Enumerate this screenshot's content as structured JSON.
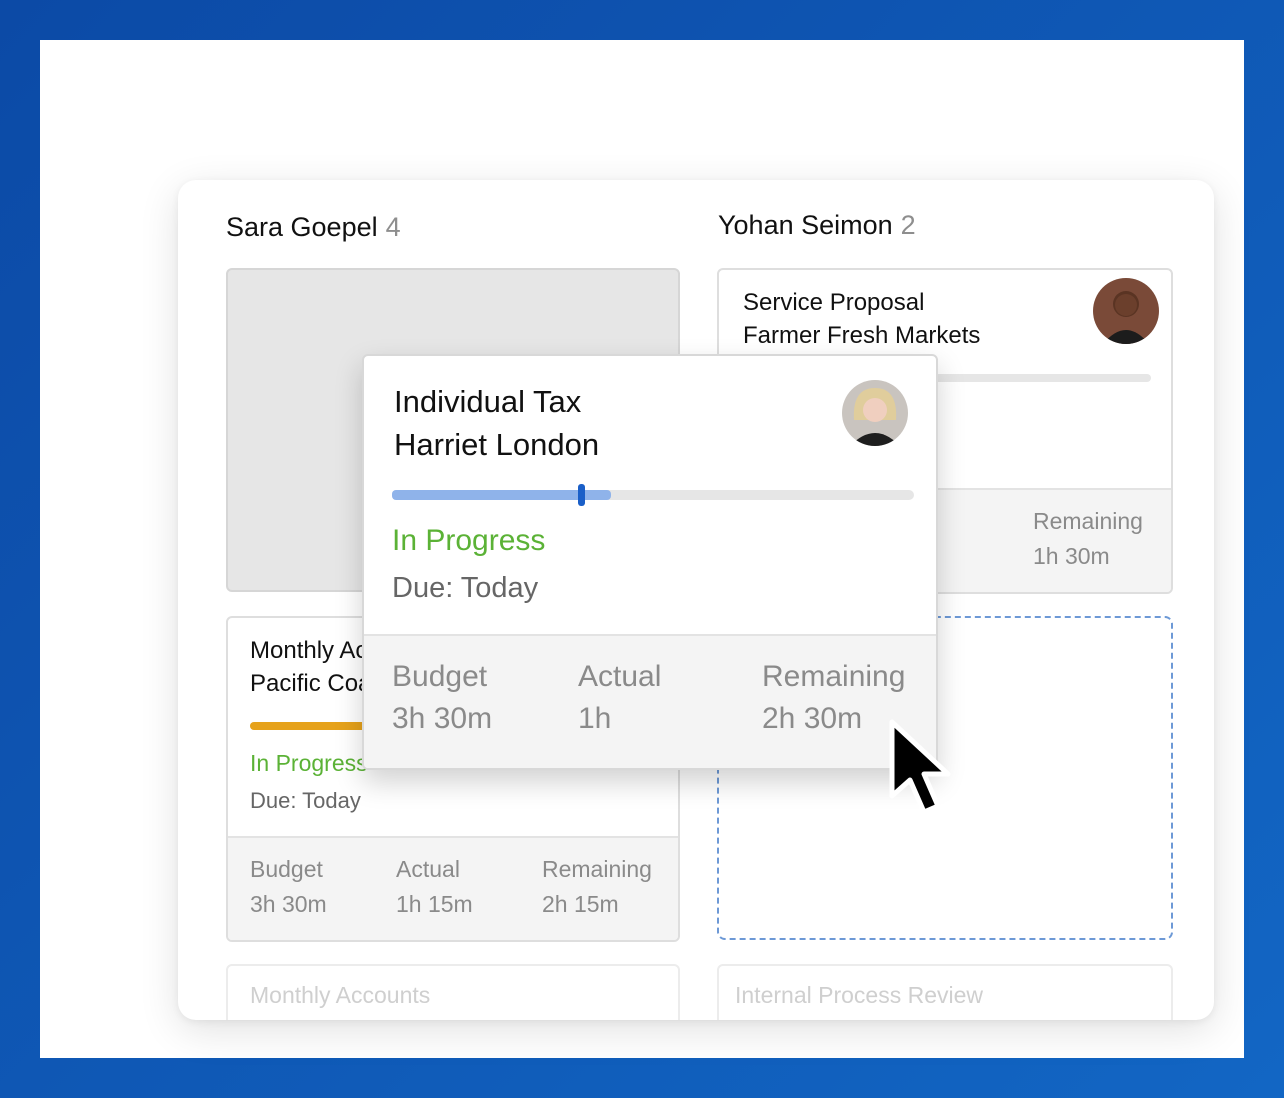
{
  "columns": [
    {
      "name": "Sara Goepel",
      "count": "4"
    },
    {
      "name": "Yohan Seimon",
      "count": "2"
    }
  ],
  "cards": {
    "service_proposal": {
      "line1": "Service Proposal",
      "line2": "Farmer Fresh Markets",
      "progress": 0.27,
      "progress_color": "#8fb3ea",
      "handle_color": "#1a5fc8",
      "avatar": "avatar-man-icon",
      "stats": [
        {
          "label": "Remaining",
          "value": "1h 30m"
        }
      ]
    },
    "monthly_accounts": {
      "line1": "Monthly Accou",
      "line2": "Pacific Coast",
      "progress": 0.53,
      "progress_color": "#e6a21b",
      "status": "In Progress",
      "due": "Due: Today",
      "stats": [
        {
          "label": "Budget",
          "value": "3h 30m"
        },
        {
          "label": "Actual",
          "value": "1h 15m"
        },
        {
          "label": "Remaining",
          "value": "2h 15m"
        }
      ]
    },
    "dragged": {
      "line1": "Individual Tax",
      "line2": "Harriet London",
      "progress": 0.42,
      "progress_color": "#8fb3ea",
      "handle_color": "#1a5fc8",
      "avatar": "avatar-woman-icon",
      "status": "In Progress",
      "due": "Due: Today",
      "stats": [
        {
          "label": "Budget",
          "value": "3h 30m"
        },
        {
          "label": "Actual",
          "value": "1h"
        },
        {
          "label": "Remaining",
          "value": "2h 30m"
        }
      ]
    },
    "ghost_left": {
      "title": "Monthly Accounts"
    },
    "ghost_right": {
      "title": "Internal Process Review"
    }
  },
  "colors": {
    "status_green": "#5bb236",
    "background_blue": "#0c4aa6",
    "dropzone_border": "#6d99d6"
  }
}
